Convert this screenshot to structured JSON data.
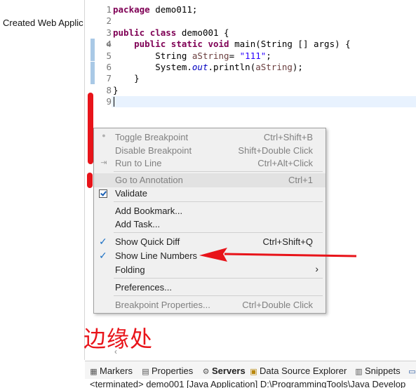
{
  "project_explorer": {
    "item": "Created Web Applic"
  },
  "editor": {
    "line_numbers": [
      "1",
      "2",
      "3",
      "4",
      "5",
      "6",
      "7",
      "8",
      "9"
    ],
    "code": {
      "l1_kw": "package",
      "l1_rest": " demo011;",
      "l3_kw1": "public",
      "l3_kw2": "class",
      "l3_rest": " demo001 {",
      "l4_kw1": "public",
      "l4_kw2": "static",
      "l4_kw3": "void",
      "l4_rest": " main(String [] args) {",
      "l5_type": "String ",
      "l5_var": "aString",
      "l5_eq": "= ",
      "l5_str": "\"111\"",
      "l5_end": ";",
      "l6_obj": "System.",
      "l6_field": "out",
      "l6_call": ".println(",
      "l6_var": "aString",
      "l6_end": ");",
      "l7": "}",
      "l8": "}"
    },
    "fold_marker": "⊖"
  },
  "context_menu": {
    "items": [
      {
        "label": "Toggle Breakpoint",
        "shortcut": "Ctrl+Shift+B",
        "enabled": false
      },
      {
        "label": "Disable Breakpoint",
        "shortcut": "Shift+Double Click",
        "enabled": false
      },
      {
        "label": "Run to Line",
        "shortcut": "Ctrl+Alt+Click",
        "enabled": false
      },
      {
        "label": "Go to Annotation",
        "shortcut": "Ctrl+1",
        "enabled": false
      },
      {
        "label": "Validate",
        "shortcut": "",
        "enabled": true
      },
      {
        "label": "Add Bookmark...",
        "shortcut": "",
        "enabled": true
      },
      {
        "label": "Add Task...",
        "shortcut": "",
        "enabled": true
      },
      {
        "label": "Show Quick Diff",
        "shortcut": "Ctrl+Shift+Q",
        "enabled": true,
        "checked": true
      },
      {
        "label": "Show Line Numbers",
        "shortcut": "",
        "enabled": true,
        "checked": true
      },
      {
        "label": "Folding",
        "shortcut": "›",
        "enabled": true
      },
      {
        "label": "Preferences...",
        "shortcut": "",
        "enabled": true
      },
      {
        "label": "Breakpoint Properties...",
        "shortcut": "Ctrl+Double Click",
        "enabled": false
      }
    ]
  },
  "annotation": {
    "text": "边缘处",
    "color": "#e8141a"
  },
  "bottom_tabs": [
    {
      "label": "Markers",
      "icon": "markers-icon"
    },
    {
      "label": "Properties",
      "icon": "properties-icon"
    },
    {
      "label": "Servers",
      "icon": "servers-icon",
      "active": true
    },
    {
      "label": "Data Source Explorer",
      "icon": "data-source-icon"
    },
    {
      "label": "Snippets",
      "icon": "snippets-icon"
    }
  ],
  "console": {
    "status": "<terminated> demo001 [Java Application] D:\\ProgrammingTools\\Java Develop"
  },
  "colors": {
    "keyword": "#7f0055",
    "string": "#2a00ff",
    "local_var": "#6a3e3e",
    "static_field": "#0000c0",
    "quick_diff": "#a9c9e6",
    "current_line": "#e8f2fe"
  }
}
